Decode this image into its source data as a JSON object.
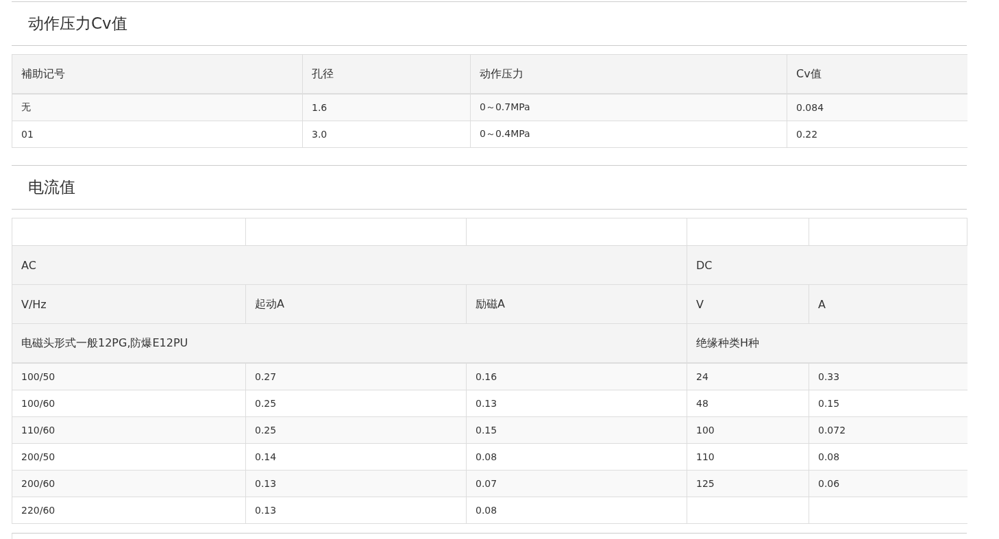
{
  "sections": [
    {
      "kind": "simple",
      "title": "动作压力Cv值",
      "columns": [
        "補助记号",
        "孔径",
        "动作压力",
        "Cv值"
      ],
      "rows": [
        [
          "无",
          "1.6",
          "0～0.7MPa",
          "0.084"
        ],
        [
          "01",
          "3.0",
          "0～0.4MPa",
          "0.22"
        ]
      ]
    },
    {
      "kind": "grouped",
      "title": "电流值",
      "groups": [
        {
          "label": "AC",
          "columns": [
            "V/Hz",
            "起动A",
            "励磁A"
          ],
          "note": "电磁头形式一般12PG,防爆E12PU",
          "rows": [
            [
              "100/50",
              "0.27",
              "0.16"
            ],
            [
              "100/60",
              "0.25",
              "0.13"
            ],
            [
              "110/60",
              "0.25",
              "0.15"
            ],
            [
              "200/50",
              "0.14",
              "0.08"
            ],
            [
              "200/60",
              "0.13",
              "0.07"
            ],
            [
              "220/60",
              "0.13",
              "0.08"
            ]
          ]
        },
        {
          "label": "DC",
          "columns": [
            "V",
            "A"
          ],
          "note": "绝缘种类H种",
          "rows": [
            [
              "24",
              "0.33"
            ],
            [
              "48",
              "0.15"
            ],
            [
              "100",
              "0.072"
            ],
            [
              "110",
              "0.08"
            ],
            [
              "125",
              "0.06"
            ]
          ]
        }
      ]
    }
  ]
}
